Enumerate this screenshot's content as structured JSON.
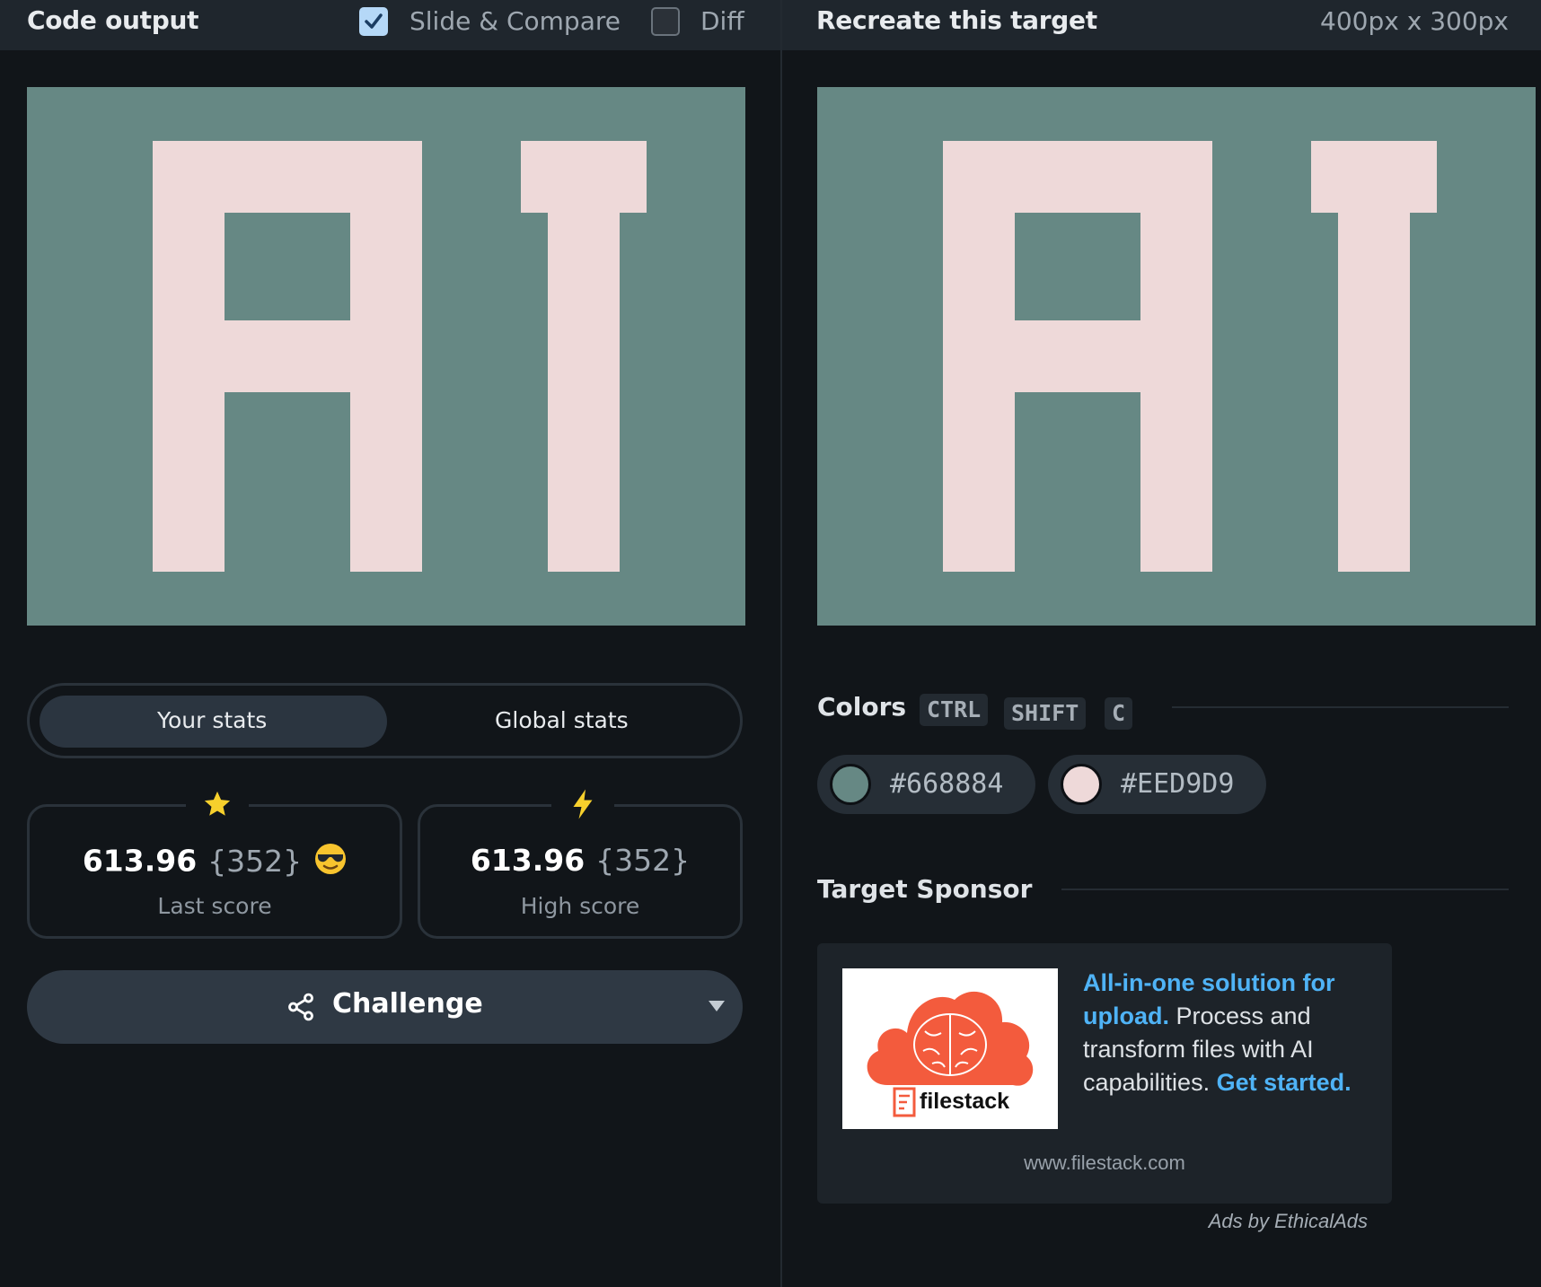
{
  "left_header": {
    "title": "Code output",
    "slide_compare_label": "Slide & Compare",
    "slide_compare_checked": true,
    "diff_label": "Diff",
    "diff_checked": false
  },
  "right_header": {
    "title": "Recreate this target",
    "size": "400px x 300px"
  },
  "stats_toggle": {
    "your_stats": "Your stats",
    "global_stats": "Global stats",
    "active": "Your stats"
  },
  "last_score": {
    "value": "613.96",
    "chars": "{352}",
    "label": "Last score",
    "badge_icon": "star-icon",
    "emoji_icon": "sunglasses-emoji-icon"
  },
  "high_score": {
    "value": "613.96",
    "chars": "{352}",
    "label": "High score",
    "badge_icon": "lightning-icon"
  },
  "challenge": {
    "label": "Challenge",
    "icon": "share-icon"
  },
  "colors": {
    "title": "Colors",
    "shortcut": [
      "CTRL",
      "SHIFT",
      "C"
    ],
    "swatches": [
      {
        "hex": "#668884"
      },
      {
        "hex": "#EED9D9"
      }
    ]
  },
  "sponsor": {
    "title": "Target Sponsor",
    "logo_text": "filestack",
    "ad_highlight": "All-in-one solution for upload.",
    "ad_body": " Process and transform files with AI capabilities. ",
    "ad_cta": "Get started.",
    "url": "www.filestack.com",
    "ads_by": "Ads by EthicalAds"
  },
  "theme": {
    "canvas_bg": "#668884",
    "canvas_fg": "#eed9d9",
    "accent": "#4fb3f6",
    "checkbox_checked": "#b5d8f7"
  }
}
